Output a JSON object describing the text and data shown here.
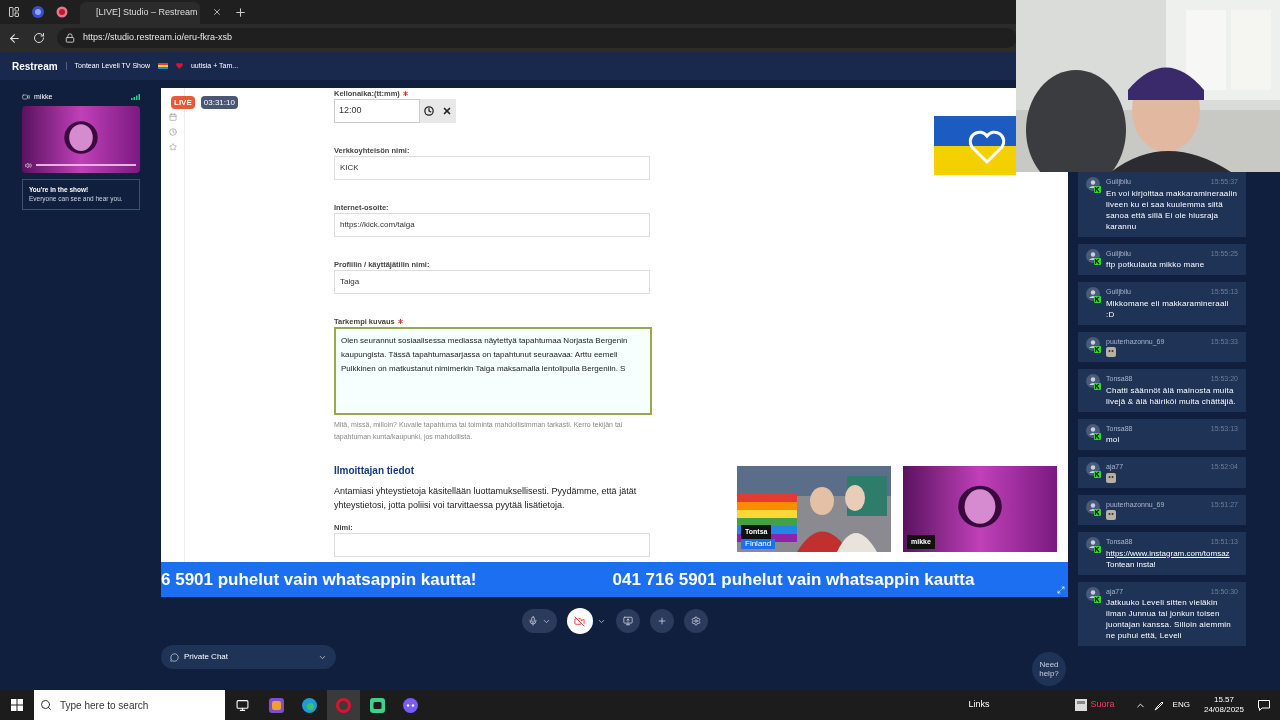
{
  "browser": {
    "tab_title": "[LIVE] Studio – Restream",
    "url": "https://studio.restream.io/eru-fkra-xsb"
  },
  "header": {
    "logo": "Restream",
    "title_start": "Tontean Leveli TV Show",
    "title_end": "uutisia + Tam..."
  },
  "participant": {
    "name": "mikke",
    "notice_title": "You're in the show!",
    "notice_text": "Everyone can see and hear you."
  },
  "stage": {
    "live_badge": "LIVE",
    "timer": "03:31:10",
    "fields": [
      {
        "kind": "time",
        "label": "Kellonaika:(tt:mm)",
        "required": true,
        "value": "12:00"
      },
      {
        "kind": "text",
        "label": "Verkkoyhteisön nimi:",
        "required": false,
        "value": "KICK"
      },
      {
        "kind": "text",
        "label": "Internet-osoite:",
        "required": false,
        "value": "https://kick.com/taiga"
      },
      {
        "kind": "text",
        "label": "Profiilin / käyttäjätilin nimi:",
        "required": false,
        "value": "Taiga"
      },
      {
        "kind": "textarea",
        "label": "Tarkempi kuvaus",
        "required": true,
        "focused": true,
        "value": "Olen seurannut sosiaalisessa mediassa näytettyä tapahtumaa Norjasta Bergenin kaupungista. Tässä tapahtumasarjassa on tapahtunut seuraavaa: Arttu eemeli Pulkkinen on matkustanut nimimerkin Taiga maksamalla lentolipulla Bergeniin. S",
        "hint": "Mitä, missä, milloin? Kuvaile tapahtuma tai toiminta mahdollisimman tarkasti. Kerro tekijän tai tapahtuman kunta/kaupunki, jos mahdollista."
      }
    ],
    "reporter": {
      "heading": "Ilmoittajan tiedot",
      "text": "Antamiasi yhteystietoja käsitellään luottamuksellisesti. Pyydämme, että jätät yhteystietosi, jotta poliisi voi tarvittaessa pyytää lisätietoja.",
      "fields": [
        {
          "kind": "text",
          "label": "Nimi:",
          "required": false
        }
      ]
    },
    "tiles": [
      {
        "name": "Tontsa",
        "subtitle": "Finland"
      },
      {
        "name": "mikke"
      }
    ],
    "ticker": [
      "6 5901 puhelut vain whatsappin kautta!",
      "041 716 5901 puhelut vain whatsappin kautta"
    ]
  },
  "controls": {
    "mic_on": true,
    "camera_on": false
  },
  "private_chat": "Private Chat",
  "help": "Need help?",
  "chat": [
    {
      "kind": "text",
      "user": "Gulljbilu",
      "time": "15:55:37",
      "text": "En voi kirjoittaa makkaramineraalin liveen ku ei saa kuulemma siitä sanoa että sillä Ei ole hiusraja karannu"
    },
    {
      "kind": "text",
      "user": "Gulljbilu",
      "time": "15:55:25",
      "text": "ftp potkulauta mikko mane"
    },
    {
      "kind": "text",
      "user": "Gulljbilu",
      "time": "15:55:13",
      "text": "Mikkomane eli makkaramineraali :D"
    },
    {
      "kind": "emote",
      "user": "puuterhazonnu_69",
      "time": "15:53:33"
    },
    {
      "kind": "text",
      "user": "Tonsa88",
      "time": "15:53:20",
      "text": "Chatti säännöt älä mainosta muita livejä & älä häiriköi muita chättäjiä."
    },
    {
      "kind": "text",
      "user": "Tonsa88",
      "time": "15:53:13",
      "text": "moi"
    },
    {
      "kind": "emote",
      "user": "aja77",
      "time": "15:52:04"
    },
    {
      "kind": "emote",
      "user": "puuterhazonnu_69",
      "time": "15:51:27"
    },
    {
      "kind": "link",
      "user": "Tonsa88",
      "time": "15:51:13",
      "url": "https://www.instagram.com/tomsaz",
      "text": "Tontean insta!"
    },
    {
      "kind": "text",
      "user": "aja77",
      "time": "15:50:30",
      "text": "Jatkuuko Leveli sitten vieläkin ilman Junnua tai jonkun toisen juontajan kanssa. Silloin aiemmin ne puhui että, Leveli"
    }
  ],
  "taskbar": {
    "search_placeholder": "Type here to search",
    "links": "Links",
    "status": "Suora",
    "language": "ENG",
    "time": "15.57",
    "date": "24/08/2025"
  }
}
